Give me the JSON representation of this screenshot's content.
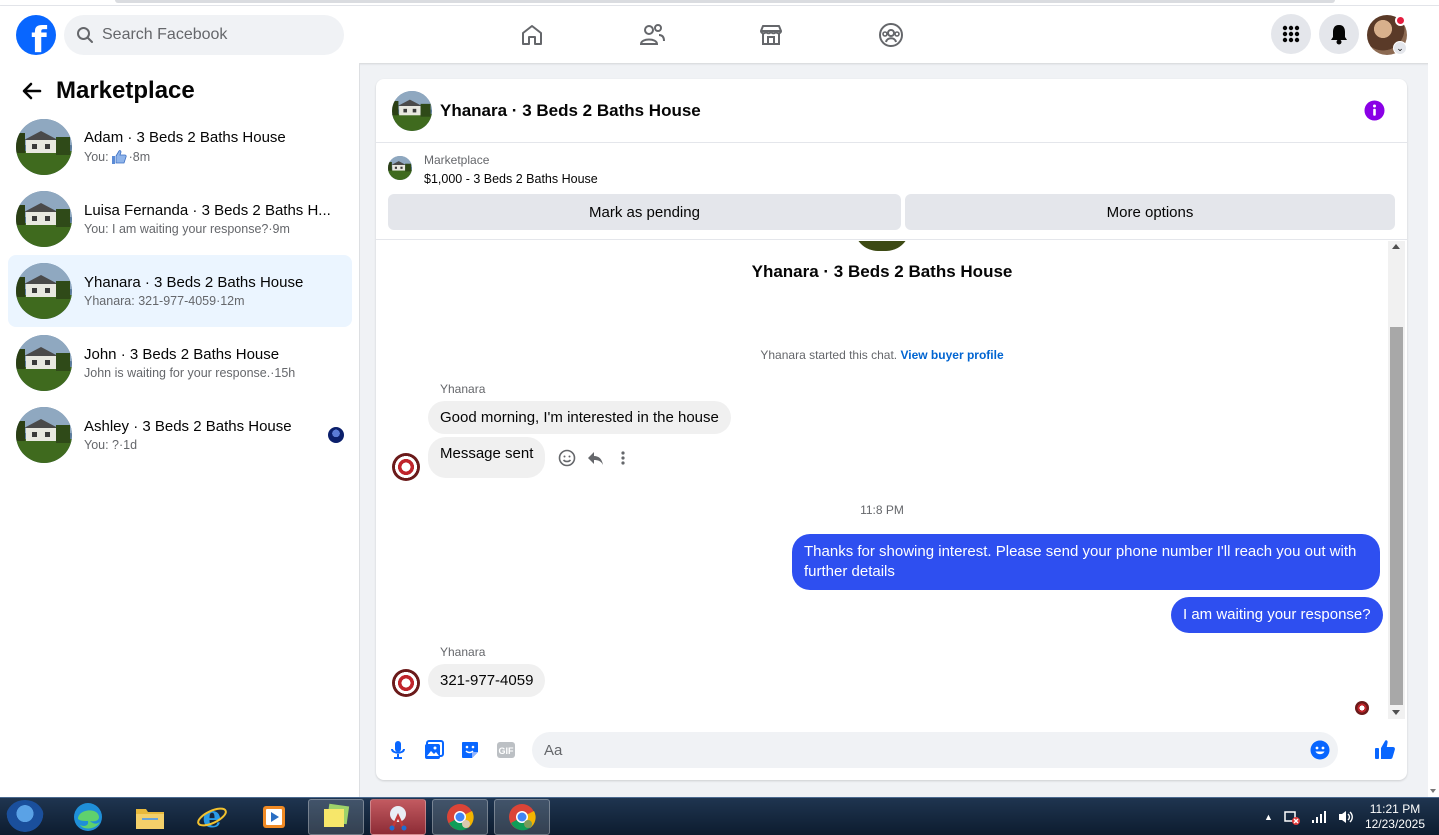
{
  "topbar": {
    "logo_letter": "f",
    "search_placeholder": "Search Facebook",
    "nav_icons": [
      "home-icon",
      "friends-icon",
      "marketplace-icon",
      "groups-icon"
    ],
    "right_icons": [
      "menu-grid-icon",
      "notifications-icon",
      "profile-avatar"
    ],
    "accent": "#0866ff"
  },
  "sidebar": {
    "title": "Marketplace",
    "conversations": [
      {
        "title": "Adam · 3 Beds 2 Baths House",
        "prefix": "You:",
        "snippet": "",
        "time": "·8m",
        "liked": true,
        "active": false
      },
      {
        "title": "Luisa Fernanda · 3 Beds 2 Baths H...",
        "prefix": "",
        "snippet": "You: I am waiting your response?",
        "time": "·9m",
        "active": false
      },
      {
        "title": "Yhanara · 3 Beds 2 Baths House",
        "prefix": "",
        "snippet": "Yhanara: 321-977-4059",
        "time": "·12m",
        "active": true
      },
      {
        "title": "John · 3 Beds 2 Baths House",
        "prefix": "",
        "snippet": "John is waiting for your response.",
        "time": "·15h",
        "active": false
      },
      {
        "title": "Ashley · 3 Beds 2 Baths House",
        "prefix": "",
        "snippet": "You: ?",
        "time": "·1d",
        "active": false
      }
    ]
  },
  "chat": {
    "header_title": "Yhanara · 3 Beds 2 Baths House",
    "listing": {
      "source": "Marketplace",
      "title": "$1,000 - 3 Beds 2 Baths House",
      "btn_pending": "Mark as pending",
      "btn_more": "More options"
    },
    "center_name": "Yhanara · 3 Beds 2 Baths House",
    "started_text": "Yhanara started this chat.",
    "view_profile": "View buyer profile",
    "sender_name": "Yhanara",
    "incoming_1": "Good morning, I'm interested in the house",
    "incoming_2": "Message sent",
    "timestamp": "11:8 PM",
    "outgoing_1": "Thanks for showing interest. Please send your phone number  I'll reach you out with further details",
    "outgoing_2": "I am waiting your response?",
    "sender_name_2": "Yhanara",
    "incoming_3": "321-977-4059",
    "composer_placeholder": "Aa",
    "outgoing_color": "#2e4ff0"
  },
  "taskbar": {
    "clock_time": "11:21 PM",
    "clock_date": "12/23/2025"
  }
}
